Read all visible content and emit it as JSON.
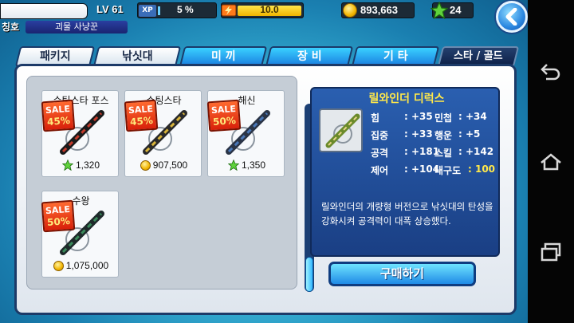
{
  "status": {
    "level": "LV 61",
    "xp_label": "XP",
    "xp_percent": "5 %",
    "xp_fill": 0.05,
    "energy": "10.0",
    "energy_fill": 1.0,
    "gold": "893,663",
    "stars": "24"
  },
  "title": {
    "label": "칭호",
    "value": "괴물 사냥꾼"
  },
  "tabs": [
    {
      "label": "패키지",
      "state": "normal"
    },
    {
      "label": "낚싯대",
      "state": "active-white"
    },
    {
      "label": "미 끼",
      "state": "active"
    },
    {
      "label": "장 비",
      "state": "active"
    },
    {
      "label": "기 타",
      "state": "active"
    },
    {
      "label": "스타 / 골드",
      "state": "dark"
    }
  ],
  "items": [
    {
      "name": "슈팅스타 포스",
      "sale_label": "SALE",
      "discount": "45%",
      "currency": "star",
      "price": "1,320"
    },
    {
      "name": "슈팅스타",
      "sale_label": "SALE",
      "discount": "45%",
      "currency": "gold",
      "price": "907,500"
    },
    {
      "name": "해신",
      "sale_label": "SALE",
      "discount": "50%",
      "currency": "star",
      "price": "1,350"
    },
    {
      "name": "수왕",
      "sale_label": "SALE",
      "discount": "50%",
      "currency": "gold",
      "price": "1,075,000"
    }
  ],
  "detail": {
    "name": "릴와인더 디럭스",
    "stats": [
      {
        "label": "힘",
        "value": ": +35"
      },
      {
        "label": "민첩",
        "value": ": +34"
      },
      {
        "label": "집중",
        "value": ": +33"
      },
      {
        "label": "행운",
        "value": ": +5"
      },
      {
        "label": "공격",
        "value": ": +181"
      },
      {
        "label": "스킬",
        "value": ": +142"
      },
      {
        "label": "제어",
        "value": ": +104"
      },
      {
        "label": "내구도",
        "value": ": 100"
      }
    ],
    "description": "릴와인더의 개량형 버전으로 낚싯대의 탄성을 강화시켜 공격력이 대폭 상승했다.",
    "buy_label": "구매하기"
  },
  "colors": {
    "accent_blue": "#1f8ae6",
    "sale_red": "#d8200a",
    "highlight_yellow": "#ffe84a"
  },
  "icons": [
    "back-arrow-icon",
    "gold-coin-icon",
    "star-icon",
    "energy-icon",
    "fishing-rod-icon",
    "nav-back-icon",
    "nav-home-icon",
    "nav-recents-icon"
  ]
}
